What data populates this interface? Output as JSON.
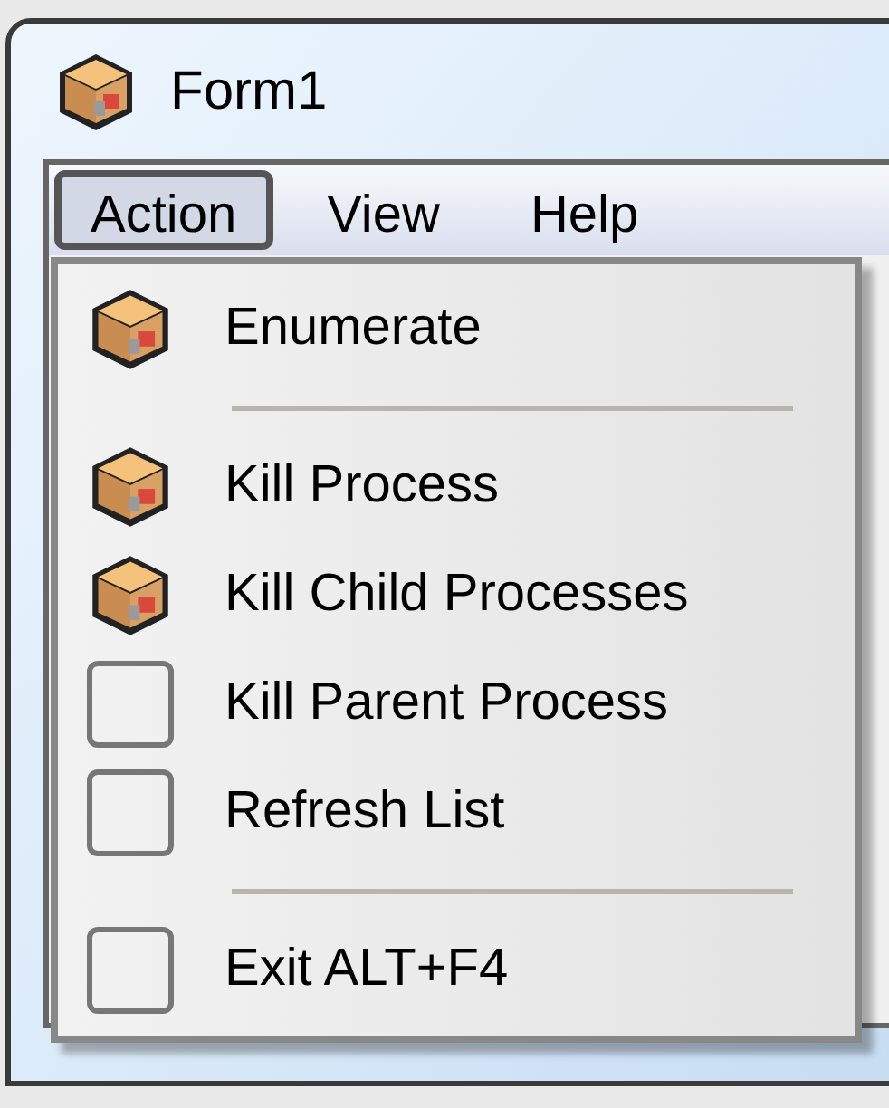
{
  "window": {
    "title": "Form1"
  },
  "menu_bar": [
    {
      "label": "Action",
      "selected": true
    },
    {
      "label": "View",
      "selected": false
    },
    {
      "label": "Help",
      "selected": false
    }
  ],
  "menu": [
    {
      "kind": "icon_item",
      "label": "Enumerate"
    },
    {
      "kind": "separator"
    },
    {
      "kind": "icon_item",
      "label": "Kill Process"
    },
    {
      "kind": "icon_item",
      "label": "Kill Child Processes"
    },
    {
      "kind": "plain_item",
      "label": "Kill Parent Process"
    },
    {
      "kind": "plain_item",
      "label": "Refresh List"
    },
    {
      "kind": "separator"
    },
    {
      "kind": "plain_item",
      "label": "Exit ALT+F4"
    }
  ]
}
